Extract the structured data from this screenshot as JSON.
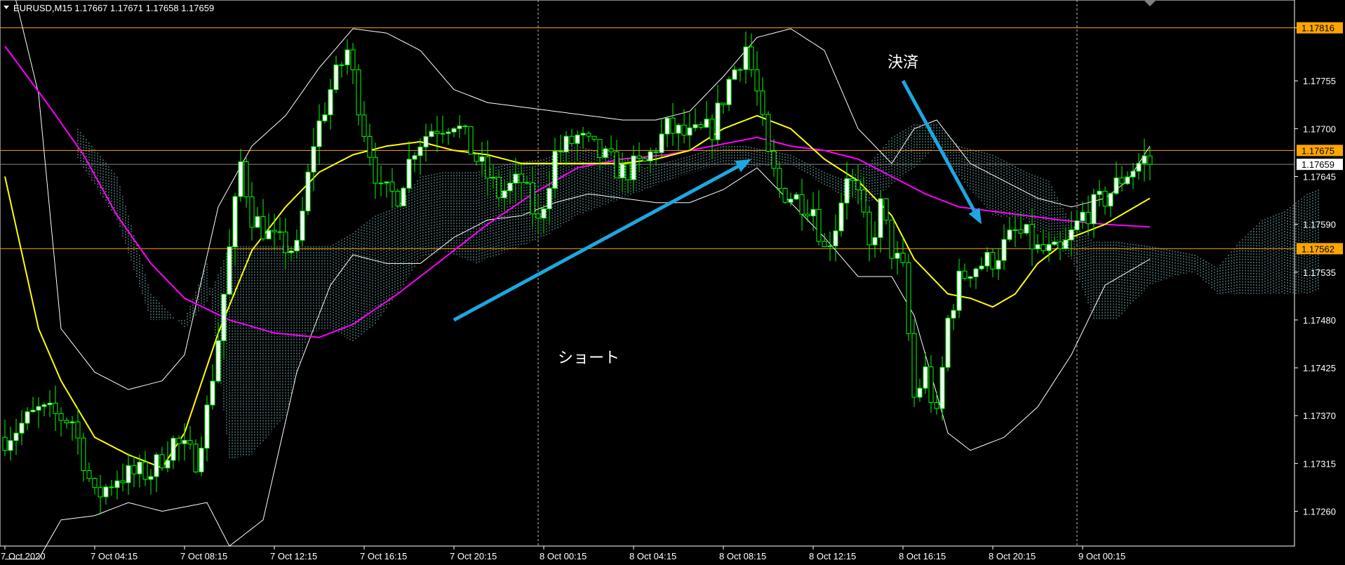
{
  "header": {
    "symbol_line": "EURUSD,M15  1.17667 1.17671 1.17658 1.17659"
  },
  "colors": {
    "background": "#000000",
    "bull_candle": "#00ff00",
    "bull_body": "#ffffff",
    "bear_candle": "#00ff00",
    "bear_body": "#000000",
    "ma_fast": "#ffff00",
    "ma_slow": "#ff00ff",
    "bollinger": "#ffffff",
    "cloud": "#8ad3d6",
    "hline": "#ffa500",
    "arrow": "#1ea7e1"
  },
  "annotations": {
    "short_label": "ショート",
    "close_label": "決済"
  },
  "chart_data": {
    "type": "candlestick",
    "title": "",
    "series_name": "",
    "ylim": [
      1.1722,
      1.17848
    ],
    "y_ticks": [
      "1.17816",
      "1.17755",
      "1.17700",
      "1.17645",
      "1.17590",
      "1.17535",
      "1.17480",
      "1.17425",
      "1.17370",
      "1.17315",
      "1.17260"
    ],
    "x_ticks": [
      "7 Oct 2020",
      "7 Oct 04:15",
      "7 Oct 08:15",
      "7 Oct 12:15",
      "7 Oct 16:15",
      "7 Oct 20:15",
      "8 Oct 00:15",
      "8 Oct 04:15",
      "8 Oct 08:15",
      "8 Oct 12:15",
      "8 Oct 16:15",
      "8 Oct 20:15",
      "9 Oct 00:15"
    ],
    "x_tick_index": [
      0,
      16,
      32,
      48,
      64,
      80,
      96,
      112,
      128,
      144,
      160,
      176,
      192
    ],
    "vertical_separators_index": [
      95,
      191
    ],
    "price_levels": [
      {
        "label": "1.17816",
        "value": 1.17816,
        "color": "#ffa500",
        "label_bg": "#ffa500",
        "label_fg": "#000000"
      },
      {
        "label": "1.17675",
        "value": 1.17675,
        "color": "#ffa500",
        "label_bg": "#ffa500",
        "label_fg": "#000000"
      },
      {
        "label": "1.17659",
        "value": 1.17659,
        "color": "#888888",
        "label_bg": "#ffffff",
        "label_fg": "#000000"
      },
      {
        "label": "1.17562",
        "value": 1.17562,
        "color": "#ffa500",
        "label_bg": "#ffa500",
        "label_fg": "#000000"
      }
    ],
    "price_anchors": [
      [
        0,
        1.17345
      ],
      [
        6,
        1.17375
      ],
      [
        12,
        1.17365
      ],
      [
        16,
        1.17275
      ],
      [
        20,
        1.173
      ],
      [
        26,
        1.17305
      ],
      [
        30,
        1.1734
      ],
      [
        34,
        1.1732
      ],
      [
        36,
        1.17375
      ],
      [
        38,
        1.1746
      ],
      [
        40,
        1.1756
      ],
      [
        42,
        1.1766
      ],
      [
        44,
        1.176
      ],
      [
        48,
        1.1757
      ],
      [
        52,
        1.1756
      ],
      [
        55,
        1.17685
      ],
      [
        58,
        1.17745
      ],
      [
        61,
        1.1779
      ],
      [
        64,
        1.177
      ],
      [
        67,
        1.17625
      ],
      [
        70,
        1.17625
      ],
      [
        73,
        1.1768
      ],
      [
        76,
        1.177
      ],
      [
        80,
        1.1771
      ],
      [
        84,
        1.17665
      ],
      [
        88,
        1.17625
      ],
      [
        92,
        1.1764
      ],
      [
        95,
        1.1759
      ],
      [
        98,
        1.1767
      ],
      [
        102,
        1.1769
      ],
      [
        106,
        1.1767
      ],
      [
        110,
        1.1765
      ],
      [
        114,
        1.1766
      ],
      [
        118,
        1.177
      ],
      [
        122,
        1.1769
      ],
      [
        126,
        1.177
      ],
      [
        129,
        1.17755
      ],
      [
        132,
        1.17795
      ],
      [
        134,
        1.1774
      ],
      [
        136,
        1.17665
      ],
      [
        138,
        1.1763
      ],
      [
        141,
        1.1762
      ],
      [
        144,
        1.1761
      ],
      [
        146,
        1.1756
      ],
      [
        148,
        1.1759
      ],
      [
        150,
        1.1765
      ],
      [
        152,
        1.1762
      ],
      [
        154,
        1.1756
      ],
      [
        156,
        1.1761
      ],
      [
        158,
        1.1756
      ],
      [
        160,
        1.17535
      ],
      [
        162,
        1.1739
      ],
      [
        164,
        1.1742
      ],
      [
        166,
        1.17365
      ],
      [
        168,
        1.1748
      ],
      [
        170,
        1.17525
      ],
      [
        172,
        1.1754
      ],
      [
        176,
        1.1755
      ],
      [
        180,
        1.1758
      ],
      [
        182,
        1.17575
      ],
      [
        184,
        1.1756
      ],
      [
        188,
        1.17555
      ],
      [
        192,
        1.176
      ],
      [
        196,
        1.1762
      ],
      [
        200,
        1.1765
      ],
      [
        203,
        1.17665
      ],
      [
        204,
        1.17659
      ]
    ],
    "ma_fast_anchors": [
      [
        0,
        1.17645
      ],
      [
        6,
        1.1747
      ],
      [
        10,
        1.1741
      ],
      [
        16,
        1.17345
      ],
      [
        22,
        1.17325
      ],
      [
        28,
        1.1731
      ],
      [
        32,
        1.1735
      ],
      [
        38,
        1.17465
      ],
      [
        44,
        1.1756
      ],
      [
        50,
        1.1761
      ],
      [
        56,
        1.1765
      ],
      [
        62,
        1.1767
      ],
      [
        68,
        1.1768
      ],
      [
        74,
        1.17685
      ],
      [
        80,
        1.17675
      ],
      [
        86,
        1.1767
      ],
      [
        92,
        1.1766
      ],
      [
        98,
        1.1766
      ],
      [
        104,
        1.1766
      ],
      [
        110,
        1.1766
      ],
      [
        116,
        1.17665
      ],
      [
        122,
        1.17675
      ],
      [
        128,
        1.177
      ],
      [
        134,
        1.17715
      ],
      [
        140,
        1.177
      ],
      [
        146,
        1.17665
      ],
      [
        152,
        1.1764
      ],
      [
        158,
        1.176
      ],
      [
        162,
        1.1755
      ],
      [
        168,
        1.1751
      ],
      [
        172,
        1.17505
      ],
      [
        176,
        1.17495
      ],
      [
        180,
        1.1751
      ],
      [
        184,
        1.17545
      ],
      [
        190,
        1.17575
      ],
      [
        196,
        1.1759
      ],
      [
        200,
        1.17605
      ],
      [
        204,
        1.1762
      ]
    ],
    "ma_slow_anchors": [
      [
        0,
        1.17795
      ],
      [
        8,
        1.17725
      ],
      [
        14,
        1.1767
      ],
      [
        20,
        1.176
      ],
      [
        26,
        1.17545
      ],
      [
        32,
        1.17505
      ],
      [
        40,
        1.1748
      ],
      [
        48,
        1.17465
      ],
      [
        56,
        1.1746
      ],
      [
        62,
        1.17475
      ],
      [
        70,
        1.1751
      ],
      [
        78,
        1.1755
      ],
      [
        86,
        1.1759
      ],
      [
        94,
        1.17625
      ],
      [
        102,
        1.17655
      ],
      [
        110,
        1.17665
      ],
      [
        118,
        1.1767
      ],
      [
        126,
        1.1768
      ],
      [
        134,
        1.1769
      ],
      [
        140,
        1.1768
      ],
      [
        146,
        1.17675
      ],
      [
        152,
        1.17665
      ],
      [
        158,
        1.17645
      ],
      [
        164,
        1.17625
      ],
      [
        170,
        1.1761
      ],
      [
        176,
        1.17605
      ],
      [
        182,
        1.176
      ],
      [
        188,
        1.17595
      ],
      [
        196,
        1.1759
      ],
      [
        204,
        1.17587
      ]
    ],
    "bb_upper_anchors": [
      [
        0,
        1.179
      ],
      [
        6,
        1.1774
      ],
      [
        10,
        1.1747
      ],
      [
        16,
        1.1742
      ],
      [
        22,
        1.174
      ],
      [
        28,
        1.1741
      ],
      [
        32,
        1.1744
      ],
      [
        38,
        1.1761
      ],
      [
        44,
        1.1768
      ],
      [
        50,
        1.17715
      ],
      [
        56,
        1.1777
      ],
      [
        62,
        1.17815
      ],
      [
        68,
        1.1781
      ],
      [
        74,
        1.1779
      ],
      [
        80,
        1.17745
      ],
      [
        86,
        1.1773
      ],
      [
        92,
        1.17725
      ],
      [
        98,
        1.1772
      ],
      [
        104,
        1.17715
      ],
      [
        110,
        1.1771
      ],
      [
        116,
        1.1771
      ],
      [
        122,
        1.1772
      ],
      [
        128,
        1.1776
      ],
      [
        134,
        1.17805
      ],
      [
        140,
        1.17815
      ],
      [
        146,
        1.1779
      ],
      [
        152,
        1.177
      ],
      [
        158,
        1.1766
      ],
      [
        162,
        1.177
      ],
      [
        166,
        1.1771
      ],
      [
        172,
        1.1766
      ],
      [
        178,
        1.1764
      ],
      [
        184,
        1.1762
      ],
      [
        190,
        1.1761
      ],
      [
        196,
        1.1762
      ],
      [
        200,
        1.1764
      ],
      [
        204,
        1.1768
      ]
    ],
    "bb_lower_anchors": [
      [
        0,
        1.17205
      ],
      [
        6,
        1.17205
      ],
      [
        10,
        1.1725
      ],
      [
        16,
        1.17255
      ],
      [
        22,
        1.1727
      ],
      [
        28,
        1.1726
      ],
      [
        32,
        1.17265
      ],
      [
        36,
        1.1727
      ],
      [
        40,
        1.1722
      ],
      [
        46,
        1.1725
      ],
      [
        52,
        1.1742
      ],
      [
        58,
        1.1752
      ],
      [
        62,
        1.17555
      ],
      [
        68,
        1.17545
      ],
      [
        74,
        1.17545
      ],
      [
        80,
        1.17575
      ],
      [
        86,
        1.17595
      ],
      [
        92,
        1.176
      ],
      [
        98,
        1.17615
      ],
      [
        104,
        1.17625
      ],
      [
        110,
        1.1762
      ],
      [
        116,
        1.17615
      ],
      [
        122,
        1.17615
      ],
      [
        128,
        1.1763
      ],
      [
        134,
        1.17655
      ],
      [
        140,
        1.17615
      ],
      [
        146,
        1.17575
      ],
      [
        152,
        1.1753
      ],
      [
        158,
        1.1753
      ],
      [
        162,
        1.17485
      ],
      [
        168,
        1.1735
      ],
      [
        172,
        1.1733
      ],
      [
        178,
        1.17345
      ],
      [
        184,
        1.1738
      ],
      [
        190,
        1.1744
      ],
      [
        196,
        1.1752
      ],
      [
        200,
        1.17535
      ],
      [
        204,
        1.1755
      ]
    ],
    "cloud_anchors": [
      [
        13,
        1.177,
        1.17665
      ],
      [
        20,
        1.17645,
        1.17595
      ],
      [
        26,
        1.1751,
        1.1748
      ],
      [
        32,
        1.1747,
        1.1748
      ],
      [
        36,
        1.175,
        1.17545
      ],
      [
        40,
        1.17565,
        1.1732
      ],
      [
        44,
        1.17565,
        1.17325
      ],
      [
        50,
        1.17565,
        1.1737
      ],
      [
        54,
        1.17565,
        1.17465
      ],
      [
        58,
        1.17565,
        1.1747
      ],
      [
        62,
        1.1758,
        1.17455
      ],
      [
        66,
        1.176,
        1.17475
      ],
      [
        70,
        1.1761,
        1.1751
      ],
      [
        74,
        1.17645,
        1.1755
      ],
      [
        78,
        1.1765,
        1.1756
      ],
      [
        84,
        1.1765,
        1.17545
      ],
      [
        90,
        1.1766,
        1.1756
      ],
      [
        96,
        1.17665,
        1.17575
      ],
      [
        102,
        1.1768,
        1.176
      ],
      [
        108,
        1.1767,
        1.17615
      ],
      [
        114,
        1.17655,
        1.1763
      ],
      [
        120,
        1.17665,
        1.17645
      ],
      [
        128,
        1.1768,
        1.1766
      ],
      [
        132,
        1.1768,
        1.17655
      ],
      [
        140,
        1.1767,
        1.1766
      ],
      [
        146,
        1.1765,
        1.17635
      ],
      [
        150,
        1.1764,
        1.1762
      ],
      [
        154,
        1.1766,
        1.17615
      ],
      [
        158,
        1.1769,
        1.17635
      ],
      [
        162,
        1.17705,
        1.17655
      ],
      [
        166,
        1.17705,
        1.1768
      ],
      [
        170,
        1.1768,
        1.17645
      ],
      [
        176,
        1.1767,
        1.176
      ],
      [
        182,
        1.1765,
        1.17595
      ],
      [
        186,
        1.1764,
        1.1757
      ],
      [
        190,
        1.1759,
        1.1755
      ],
      [
        194,
        1.1757,
        1.1748
      ],
      [
        198,
        1.1757,
        1.1748
      ],
      [
        204,
        1.17565,
        1.1752
      ],
      [
        208,
        1.1756,
        1.1753
      ],
      [
        212,
        1.17555,
        1.17535
      ],
      [
        216,
        1.1754,
        1.1751
      ],
      [
        220,
        1.1757,
        1.1751
      ],
      [
        224,
        1.17595,
        1.1751
      ],
      [
        228,
        1.17605,
        1.1751
      ],
      [
        232,
        1.17625,
        1.1751
      ],
      [
        234,
        1.1763,
        1.17515
      ]
    ],
    "arrows": [
      {
        "name": "short-arrow",
        "from": [
          80,
          1.1748
        ],
        "to": [
          133,
          1.17665
        ]
      },
      {
        "name": "close-arrow",
        "from": [
          160,
          1.17755
        ],
        "to": [
          174,
          1.1759
        ]
      }
    ]
  }
}
